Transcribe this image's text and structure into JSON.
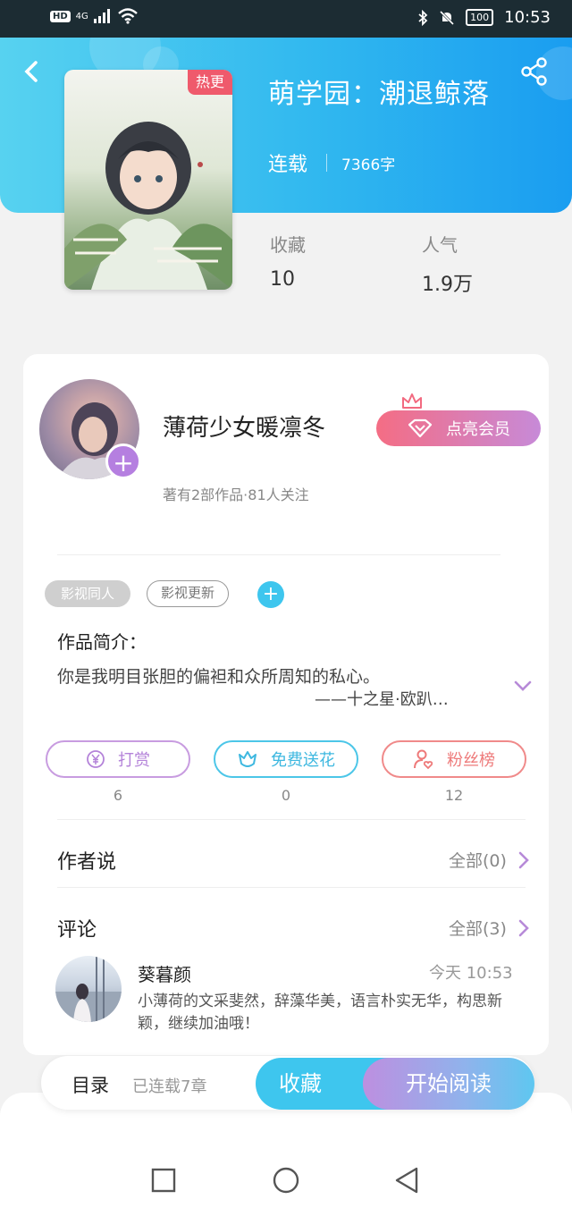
{
  "statusbar": {
    "hd": "HD",
    "signal": "4G",
    "battery": "100",
    "time": "10:53"
  },
  "header": {
    "hot_badge": "热更",
    "title": "萌学园：潮退鲸落",
    "status": "连载",
    "word_count": "7366字",
    "stats": [
      {
        "label": "收藏",
        "value": "10"
      },
      {
        "label": "人气",
        "value": "1.9万"
      }
    ]
  },
  "author": {
    "name": "薄荷少女暖凛冬",
    "vip_button": "点亮会员",
    "meta": "著有2部作品·81人关注"
  },
  "tags": [
    "影视同人",
    "影视更新"
  ],
  "intro": {
    "label": "作品简介：",
    "text": "你是我明目张胆的偏袒和众所周知的私心。",
    "sign": "——十之星·欧趴…"
  },
  "actions": [
    {
      "label": "打赏",
      "count": "6",
      "icon": "yen-icon"
    },
    {
      "label": "免费送花",
      "count": "0",
      "icon": "flower-icon"
    },
    {
      "label": "粉丝榜",
      "count": "12",
      "icon": "user-heart-icon"
    }
  ],
  "author_says": {
    "title": "作者说",
    "more": "全部(0)"
  },
  "comments": {
    "title": "评论",
    "more": "全部(3)",
    "items": [
      {
        "user": "葵暮颜",
        "time": "今天  10:53",
        "text": "小薄荷的文采斐然，辞藻华美，语言朴实无华，构思新颖，继续加油哦！"
      }
    ]
  },
  "bottom": {
    "toc": "目录",
    "serial": "已连载7章",
    "favorite": "收藏",
    "read": "开始阅读"
  },
  "colors": {
    "accent_blue": "#3ec6ee",
    "hot_red": "#ef5a6c",
    "purple": "#b57fe0"
  }
}
